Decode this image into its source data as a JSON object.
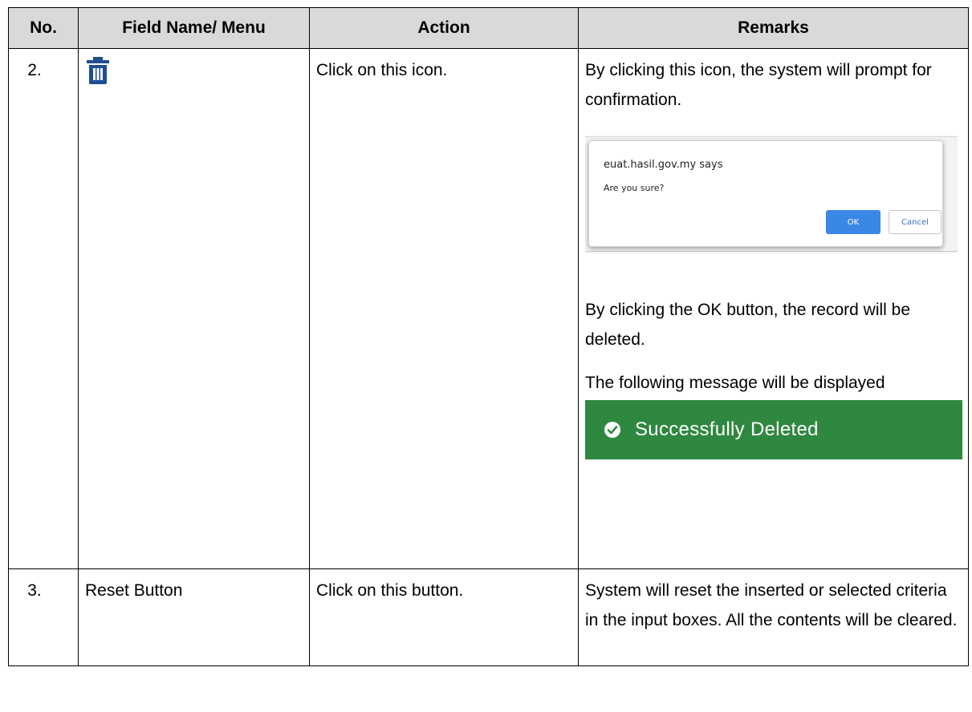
{
  "headers": {
    "no": "No.",
    "field": "Field Name/ Menu",
    "action": "Action",
    "remarks": "Remarks"
  },
  "rows": [
    {
      "no": "2.",
      "field_icon": "trash-icon",
      "action": "Click on this icon.",
      "remarks": {
        "intro": "By clicking this icon, the system will prompt for confirmation.",
        "dialog": {
          "origin": "euat.hasil.gov.my says",
          "message": "Are you sure?",
          "ok_label": "OK",
          "cancel_label": "Cancel"
        },
        "after_ok": "By clicking the OK button, the record will be deleted.",
        "message_intro": "The following message will be displayed",
        "success_message": "Successfully Deleted"
      }
    },
    {
      "no": "3.",
      "field": "Reset Button",
      "action": "Click on this button.",
      "remarks": "System will reset the inserted or selected criteria in the input boxes. All the contents will be cleared."
    }
  ],
  "colors": {
    "header_bg": "#d9d9d9",
    "icon_blue": "#1f4e93",
    "success_green": "#2f8840",
    "ok_blue": "#3b87e6"
  }
}
